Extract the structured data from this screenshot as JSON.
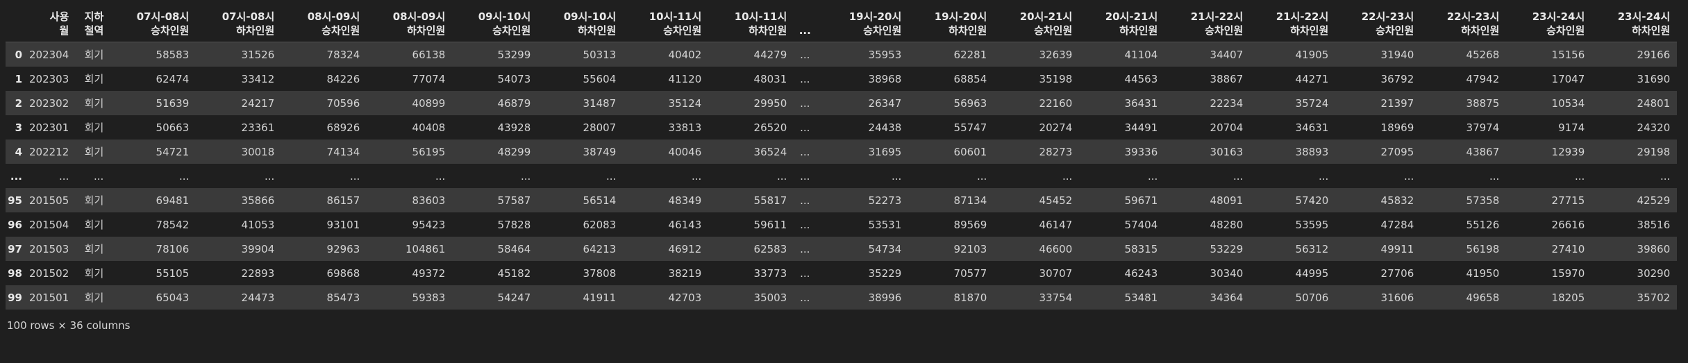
{
  "table": {
    "headers": [
      "",
      "사용\n월",
      "지하\n철역",
      "07시-08시\n승차인원",
      "07시-08시\n하차인원",
      "08시-09시\n승차인원",
      "08시-09시\n하차인원",
      "09시-10시\n승차인원",
      "09시-10시\n하차인원",
      "10시-11시\n승차인원",
      "10시-11시\n하차인원",
      "...",
      "19시-20시\n승차인원",
      "19시-20시\n하차인원",
      "20시-21시\n승차인원",
      "20시-21시\n하차인원",
      "21시-22시\n승차인원",
      "21시-22시\n하차인원",
      "22시-23시\n승차인원",
      "22시-23시\n하차인원",
      "23시-24시\n승차인원",
      "23시-24시\n하차인원"
    ],
    "rows": [
      [
        "0",
        "202304",
        "회기",
        "58583",
        "31526",
        "78324",
        "66138",
        "53299",
        "50313",
        "40402",
        "44279",
        "...",
        "35953",
        "62281",
        "32639",
        "41104",
        "34407",
        "41905",
        "31940",
        "45268",
        "15156",
        "29166"
      ],
      [
        "1",
        "202303",
        "회기",
        "62474",
        "33412",
        "84226",
        "77074",
        "54073",
        "55604",
        "41120",
        "48031",
        "...",
        "38968",
        "68854",
        "35198",
        "44563",
        "38867",
        "44271",
        "36792",
        "47942",
        "17047",
        "31690"
      ],
      [
        "2",
        "202302",
        "회기",
        "51639",
        "24217",
        "70596",
        "40899",
        "46879",
        "31487",
        "35124",
        "29950",
        "...",
        "26347",
        "56963",
        "22160",
        "36431",
        "22234",
        "35724",
        "21397",
        "38875",
        "10534",
        "24801"
      ],
      [
        "3",
        "202301",
        "회기",
        "50663",
        "23361",
        "68926",
        "40408",
        "43928",
        "28007",
        "33813",
        "26520",
        "...",
        "24438",
        "55747",
        "20274",
        "34491",
        "20704",
        "34631",
        "18969",
        "37974",
        "9174",
        "24320"
      ],
      [
        "4",
        "202212",
        "회기",
        "54721",
        "30018",
        "74134",
        "56195",
        "48299",
        "38749",
        "40046",
        "36524",
        "...",
        "31695",
        "60601",
        "28273",
        "39336",
        "30163",
        "38893",
        "27095",
        "43867",
        "12939",
        "29198"
      ],
      [
        "...",
        "...",
        "...",
        "...",
        "...",
        "...",
        "...",
        "...",
        "...",
        "...",
        "...",
        "...",
        "...",
        "...",
        "...",
        "...",
        "...",
        "...",
        "...",
        "...",
        "...",
        "..."
      ],
      [
        "95",
        "201505",
        "회기",
        "69481",
        "35866",
        "86157",
        "83603",
        "57587",
        "56514",
        "48349",
        "55817",
        "...",
        "52273",
        "87134",
        "45452",
        "59671",
        "48091",
        "57420",
        "45832",
        "57358",
        "27715",
        "42529"
      ],
      [
        "96",
        "201504",
        "회기",
        "78542",
        "41053",
        "93101",
        "95423",
        "57828",
        "62083",
        "46143",
        "59611",
        "...",
        "53531",
        "89569",
        "46147",
        "57404",
        "48280",
        "53595",
        "47284",
        "55126",
        "26616",
        "38516"
      ],
      [
        "97",
        "201503",
        "회기",
        "78106",
        "39904",
        "92963",
        "104861",
        "58464",
        "64213",
        "46912",
        "62583",
        "...",
        "54734",
        "92103",
        "46600",
        "58315",
        "53229",
        "56312",
        "49911",
        "56198",
        "27410",
        "39860"
      ],
      [
        "98",
        "201502",
        "회기",
        "55105",
        "22893",
        "69868",
        "49372",
        "45182",
        "37808",
        "38219",
        "33773",
        "...",
        "35229",
        "70577",
        "30707",
        "46243",
        "30340",
        "44995",
        "27706",
        "41950",
        "15970",
        "30290"
      ],
      [
        "99",
        "201501",
        "회기",
        "65043",
        "24473",
        "85473",
        "59383",
        "54247",
        "41911",
        "42703",
        "35003",
        "...",
        "38996",
        "81870",
        "33754",
        "53481",
        "34364",
        "50706",
        "31606",
        "49658",
        "18205",
        "35702"
      ]
    ]
  },
  "footer": "100 rows × 36 columns"
}
